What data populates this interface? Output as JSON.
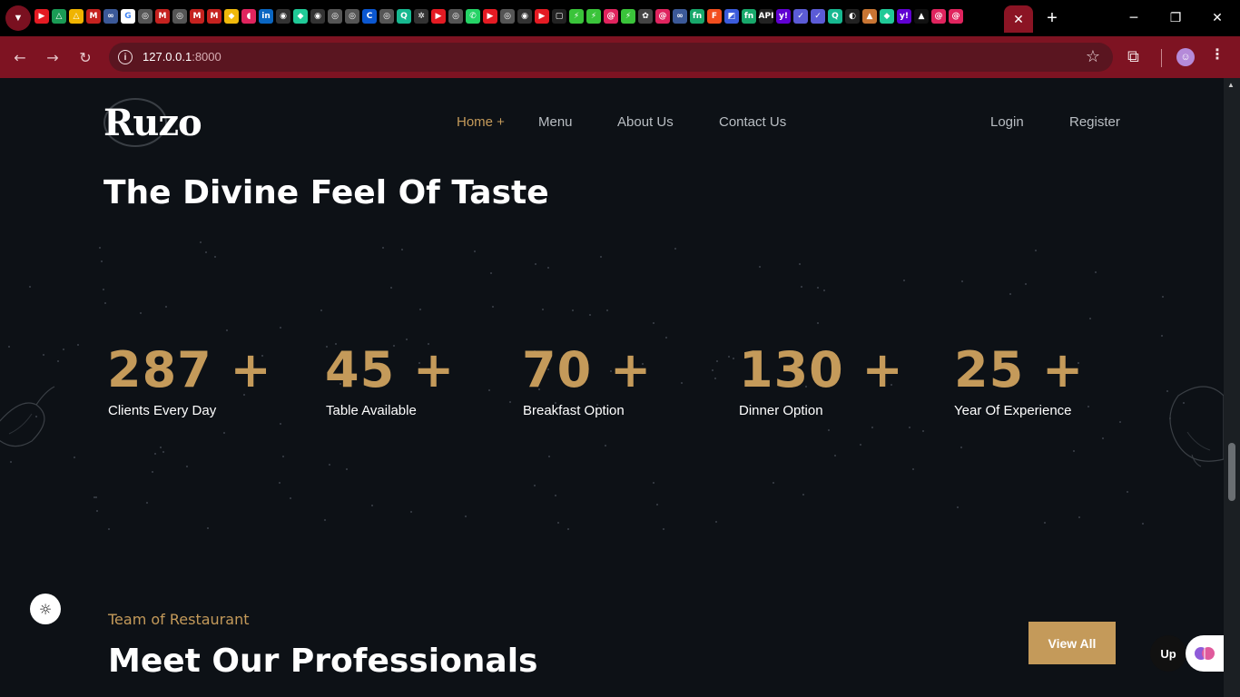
{
  "browser": {
    "tab_menu_icon": "chevron-down-icon",
    "favicons": [
      {
        "name": "youtube",
        "color": "#e41b23",
        "glyph": "▶"
      },
      {
        "name": "drive",
        "color": "#1a9b55",
        "glyph": "△"
      },
      {
        "name": "drive",
        "color": "#f0b400",
        "glyph": "△"
      },
      {
        "name": "gmail",
        "color": "#c5221f",
        "glyph": "M"
      },
      {
        "name": "meta",
        "color": "#3b5998",
        "glyph": "∞"
      },
      {
        "name": "google",
        "color": "#ffffff",
        "glyph": "G"
      },
      {
        "name": "globe",
        "color": "#555",
        "glyph": "◎"
      },
      {
        "name": "gmail",
        "color": "#c5221f",
        "glyph": "M"
      },
      {
        "name": "globe",
        "color": "#555",
        "glyph": "◎"
      },
      {
        "name": "gmail",
        "color": "#c5221f",
        "glyph": "M"
      },
      {
        "name": "gmail",
        "color": "#c5221f",
        "glyph": "M"
      },
      {
        "name": "binance",
        "color": "#f0b90b",
        "glyph": "◆"
      },
      {
        "name": "app",
        "color": "#e0245e",
        "glyph": "◖"
      },
      {
        "name": "linkedin",
        "color": "#0a66c2",
        "glyph": "in"
      },
      {
        "name": "github",
        "color": "#333",
        "glyph": "◉"
      },
      {
        "name": "app",
        "color": "#20c997",
        "glyph": "◆"
      },
      {
        "name": "github",
        "color": "#333",
        "glyph": "◉"
      },
      {
        "name": "globe",
        "color": "#555",
        "glyph": "◎"
      },
      {
        "name": "globe",
        "color": "#555",
        "glyph": "◎"
      },
      {
        "name": "app",
        "color": "#0b57d0",
        "glyph": "C"
      },
      {
        "name": "globe",
        "color": "#555",
        "glyph": "◎"
      },
      {
        "name": "app",
        "color": "#17b890",
        "glyph": "Q"
      },
      {
        "name": "app",
        "color": "#333",
        "glyph": "✲"
      },
      {
        "name": "youtube",
        "color": "#e41b23",
        "glyph": "▶"
      },
      {
        "name": "globe",
        "color": "#555",
        "glyph": "◎"
      },
      {
        "name": "whatsapp",
        "color": "#25d366",
        "glyph": "✆"
      },
      {
        "name": "youtube",
        "color": "#e41b23",
        "glyph": "▶"
      },
      {
        "name": "globe",
        "color": "#555",
        "glyph": "◎"
      },
      {
        "name": "github",
        "color": "#333",
        "glyph": "◉"
      },
      {
        "name": "youtube",
        "color": "#e41b23",
        "glyph": "▶"
      },
      {
        "name": "app",
        "color": "#222",
        "glyph": "▢"
      },
      {
        "name": "app",
        "color": "#3ac43a",
        "glyph": "⚡"
      },
      {
        "name": "app",
        "color": "#3ac43a",
        "glyph": "⚡"
      },
      {
        "name": "app",
        "color": "#e0245e",
        "glyph": "@"
      },
      {
        "name": "app",
        "color": "#3ac43a",
        "glyph": "⚡"
      },
      {
        "name": "openai",
        "color": "#444",
        "glyph": "✿"
      },
      {
        "name": "app",
        "color": "#e0245e",
        "glyph": "@"
      },
      {
        "name": "meta",
        "color": "#3b5998",
        "glyph": "∞"
      },
      {
        "name": "app",
        "color": "#18a86b",
        "glyph": "fn"
      },
      {
        "name": "figma",
        "color": "#f24e1e",
        "glyph": "F"
      },
      {
        "name": "app",
        "color": "#3b5bdb",
        "glyph": "◩"
      },
      {
        "name": "app",
        "color": "#18a86b",
        "glyph": "fn"
      },
      {
        "name": "api",
        "color": "#222",
        "glyph": "API"
      },
      {
        "name": "yahoo",
        "color": "#6001d2",
        "glyph": "y!"
      },
      {
        "name": "app",
        "color": "#5b5bd6",
        "glyph": "✓"
      },
      {
        "name": "app",
        "color": "#5b5bd6",
        "glyph": "✓"
      },
      {
        "name": "app",
        "color": "#17b890",
        "glyph": "Q"
      },
      {
        "name": "app",
        "color": "#222",
        "glyph": "◐"
      },
      {
        "name": "app",
        "color": "#c87533",
        "glyph": "▲"
      },
      {
        "name": "app",
        "color": "#20c997",
        "glyph": "◆"
      },
      {
        "name": "yahoo",
        "color": "#6001d2",
        "glyph": "y!"
      },
      {
        "name": "app",
        "color": "#111",
        "glyph": "▲"
      },
      {
        "name": "app",
        "color": "#e0245e",
        "glyph": "@"
      },
      {
        "name": "app",
        "color": "#e0245e",
        "glyph": "@"
      }
    ],
    "active_tab_close": "✕",
    "new_tab": "+",
    "minimize": "─",
    "restore": "❐",
    "close": "✕",
    "back": "←",
    "forward": "→",
    "reload": "↻",
    "url_host": "127.0.0.1",
    "url_port": ":8000",
    "bookmark_icon": "☆",
    "extensions_icon": "⧉",
    "menu_icon": "⋮"
  },
  "site": {
    "logo": "Ruzo",
    "nav": [
      {
        "label": "Home +",
        "active": true
      },
      {
        "label": "Menu"
      },
      {
        "label": "About Us"
      },
      {
        "label": "Contact Us"
      }
    ],
    "login": "Login",
    "register": "Register",
    "hero_title": "The Divine Feel Of Taste",
    "stats": [
      {
        "value": "287 +",
        "label": "Clients Every Day"
      },
      {
        "value": "45 +",
        "label": "Table Available"
      },
      {
        "value": "70 +",
        "label": "Breakfast Option"
      },
      {
        "value": "130 +",
        "label": "Dinner Option"
      },
      {
        "value": "25 +",
        "label": "Year Of Experience"
      }
    ],
    "team_subtitle": "Team of Restaurant",
    "team_title": "Meet Our Professionals",
    "view_all": "View All",
    "theme_toggle_icon": "sun-icon",
    "float_up": "Up"
  },
  "colors": {
    "accent": "#c49a5a",
    "background": "#0d1116",
    "chrome": "#7e1322"
  }
}
